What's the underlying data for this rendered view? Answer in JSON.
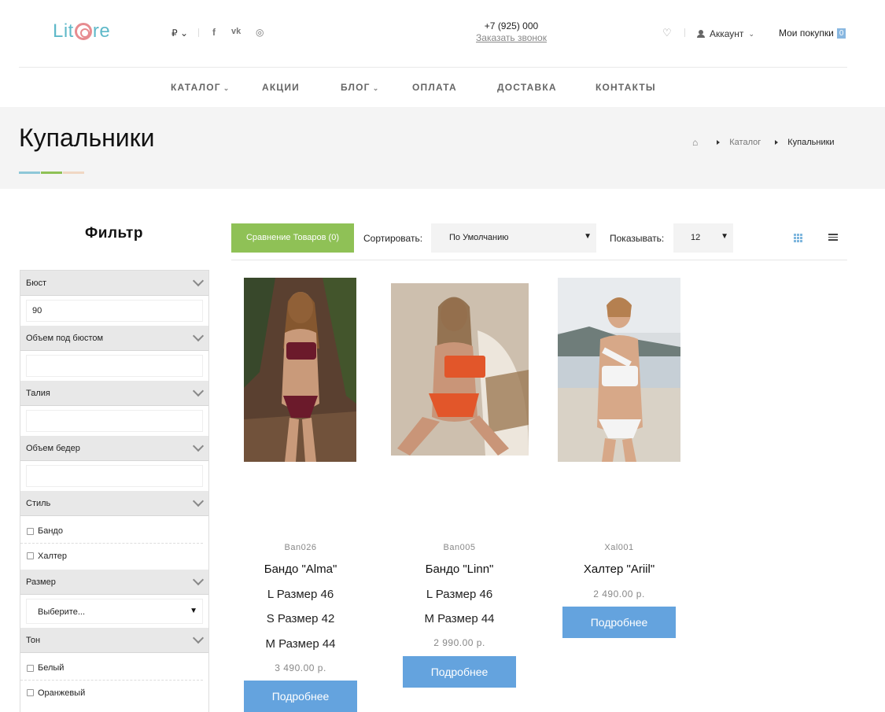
{
  "header": {
    "logo_part1": "Lit",
    "logo_part2": "re",
    "currency": "₽",
    "currency_chevron": "⌄",
    "social": [
      {
        "icon": "facebook-icon",
        "glyph": "f"
      },
      {
        "icon": "vk-icon",
        "glyph": "vk"
      },
      {
        "icon": "instagram-icon",
        "glyph": "◎"
      }
    ],
    "phone": "+7 (925) 000",
    "callback": "Заказать звонок",
    "wishlist_glyph": "♡",
    "account_label": "Аккаунт",
    "cart_label": "Мои покупки",
    "cart_count": "0"
  },
  "nav": {
    "items": [
      {
        "label": "КАТАЛОГ",
        "has_dropdown": true
      },
      {
        "label": "АКЦИИ",
        "has_dropdown": false
      },
      {
        "label": "БЛОГ",
        "has_dropdown": true
      },
      {
        "label": "ОПЛАТА",
        "has_dropdown": false
      },
      {
        "label": "ДОСТАВКА",
        "has_dropdown": false
      },
      {
        "label": "КОНТАКТЫ",
        "has_dropdown": false
      }
    ]
  },
  "page": {
    "title": "Купальники",
    "accent_colors": [
      "#8ec7d8",
      "#8fc156",
      "#f0d7c4"
    ],
    "breadcrumb": {
      "home_glyph": "⌂",
      "items": [
        "Каталог",
        "Купальники"
      ]
    }
  },
  "filter": {
    "title": "Фильтр",
    "groups": {
      "bust": {
        "label": "Бюст",
        "value": "90"
      },
      "underbust": {
        "label": "Объем под бюстом",
        "value": ""
      },
      "waist": {
        "label": "Талия",
        "value": ""
      },
      "hips": {
        "label": "Объем бедер",
        "value": ""
      },
      "style": {
        "label": "Стиль",
        "options": [
          "Бандо",
          "Халтер"
        ]
      },
      "size": {
        "label": "Размер",
        "selected": "Выберите..."
      },
      "tone": {
        "label": "Тон",
        "options": [
          "Белый",
          "Оранжевый"
        ]
      }
    }
  },
  "toolbar": {
    "compare_label": "Сравнение Товаров (0)",
    "sort_label": "Сортировать:",
    "sort_value": "По Умолчанию",
    "show_label": "Показывать:",
    "show_value": "12",
    "select_arrow": "▼"
  },
  "products": [
    {
      "sku": "Ban026",
      "name": "Бандо \"Alma\"",
      "variants": [
        "L Размер 46",
        "S Размер 42",
        "M Размер 44"
      ],
      "price": "3 490.00 р.",
      "button": "Подробнее",
      "swimsuit_color": "#6b1a2b",
      "bg": "#5a4030"
    },
    {
      "sku": "Ban005",
      "name": "Бандо \"Linn\"",
      "variants": [
        "L Размер 46",
        "M Размер 44"
      ],
      "price": "2 990.00 р.",
      "button": "Подробнее",
      "swimsuit_color": "#e2562a",
      "bg": "#cdbfae"
    },
    {
      "sku": "Xal001",
      "name": "Халтер \"Ariil\"",
      "variants": [],
      "price": "2 490.00 р.",
      "button": "Подробнее",
      "swimsuit_color": "#f4f4f4",
      "bg": "#d9dde0"
    }
  ]
}
